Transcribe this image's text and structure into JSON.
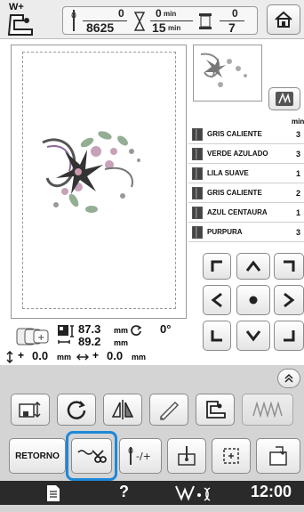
{
  "topbar": {
    "presser_foot_label": "W+",
    "stitches_done": "0",
    "stitches_total": "8625",
    "time_done": "0",
    "time_total": "15",
    "time_unit": "min",
    "colors_done": "0",
    "colors_total": "7",
    "home_icon": "home-icon"
  },
  "threads": {
    "min_header": "min",
    "items": [
      {
        "name": "GRIS CALIENTE",
        "min": "3"
      },
      {
        "name": "VERDE AZULADO",
        "min": "3"
      },
      {
        "name": "LILA SUAVE",
        "min": "1"
      },
      {
        "name": "GRIS CALIENTE",
        "min": "2"
      },
      {
        "name": "AZUL CENTAURA",
        "min": "1"
      },
      {
        "name": "PURPURA",
        "min": "3"
      }
    ]
  },
  "info": {
    "width": "87.3",
    "height": "89.2",
    "unit": "mm",
    "rotation": "0°",
    "x_offset": "0.0",
    "y_offset": "0.0",
    "x_label": "+",
    "y_label": "+"
  },
  "buttons": {
    "back_label": "RETORNO"
  },
  "statusbar": {
    "time": "12:00",
    "help": "?"
  }
}
